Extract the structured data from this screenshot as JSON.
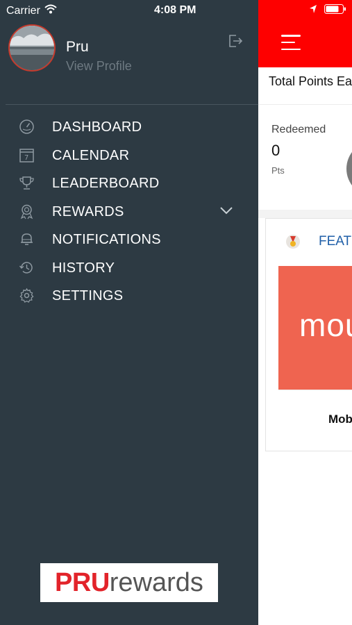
{
  "status_bar": {
    "carrier": "Carrier",
    "time": "4:08 PM",
    "icons": [
      "wifi-icon",
      "location-icon",
      "battery-icon"
    ]
  },
  "profile": {
    "name": "Pru",
    "link": "View Profile"
  },
  "menu": {
    "items": [
      {
        "label": "DASHBOARD",
        "icon": "speedometer-icon"
      },
      {
        "label": "CALENDAR",
        "icon": "calendar-icon"
      },
      {
        "label": "LEADERBOARD",
        "icon": "trophy-icon"
      },
      {
        "label": "REWARDS",
        "icon": "award-ribbon-icon",
        "has_dropdown": true
      },
      {
        "label": "NOTIFICATIONS",
        "icon": "bell-icon"
      },
      {
        "label": "HISTORY",
        "icon": "history-icon"
      },
      {
        "label": "SETTINGS",
        "icon": "gear-icon"
      }
    ]
  },
  "logo": {
    "part1": "PRU",
    "part2": "rewards"
  },
  "main": {
    "total_points_label": "Total Points Ea",
    "redeemed_label": "Redeemed",
    "redeemed_value": "0",
    "redeemed_unit": "Pts",
    "featured_label": "FEATU",
    "banner_text": "mou",
    "card_title": "Mob"
  },
  "colors": {
    "drawer_bg": "#2d3a43",
    "header_red": "#fe0000",
    "featured_blue": "#1f5fa8",
    "banner_orange": "#ef6450",
    "logo_red": "#e2232a"
  }
}
